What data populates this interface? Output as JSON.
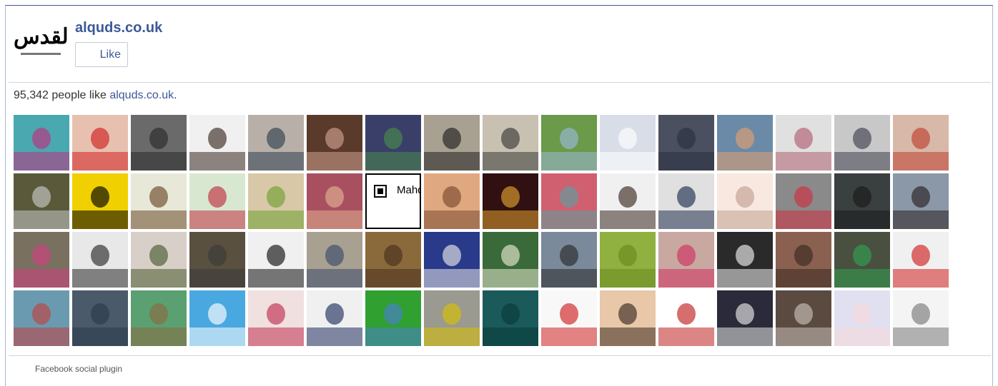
{
  "header": {
    "logo_text": "القدس",
    "page_name": "alquds.co.uk",
    "like_label": "Like"
  },
  "stats": {
    "count_text": "95,342 people like ",
    "page_link": "alquds.co.uk",
    "period": "."
  },
  "faces": [
    {
      "name": "friend-photo",
      "bg": "#4aa8b0",
      "accent": "#c03080",
      "text": ""
    },
    {
      "name": "friend-photo",
      "bg": "#e8c0b0",
      "accent": "#d02020",
      "text": ""
    },
    {
      "name": "friend-photo",
      "bg": "#6a6a6a",
      "accent": "#2a2a2a",
      "text": ""
    },
    {
      "name": "friend-photo",
      "bg": "#f0f0f0",
      "accent": "#3a2a20",
      "text": ""
    },
    {
      "name": "friend-photo",
      "bg": "#b8b0a8",
      "accent": "#304050",
      "text": ""
    },
    {
      "name": "friend-photo",
      "bg": "#5a3a2a",
      "accent": "#d0a090",
      "text": ""
    },
    {
      "name": "friend-photo",
      "bg": "#3a3f6a",
      "accent": "#4a8a4a",
      "text": ""
    },
    {
      "name": "friend-photo",
      "bg": "#a8a090",
      "accent": "#202020",
      "text": ""
    },
    {
      "name": "friend-photo",
      "bg": "#c8c0b0",
      "accent": "#3a3a3a",
      "text": ""
    },
    {
      "name": "friend-photo",
      "bg": "#6a9a4a",
      "accent": "#9ab8d8",
      "text": ""
    },
    {
      "name": "friend-photo",
      "bg": "#d8dde8",
      "accent": "#ffffff",
      "text": ""
    },
    {
      "name": "friend-photo",
      "bg": "#4a5060",
      "accent": "#2a3040",
      "text": ""
    },
    {
      "name": "friend-photo",
      "bg": "#6a8aa8",
      "accent": "#e0a070",
      "text": ""
    },
    {
      "name": "friend-photo",
      "bg": "#e0e0e0",
      "accent": "#b06070",
      "text": ""
    },
    {
      "name": "friend-photo",
      "bg": "#c8c8c8",
      "accent": "#404050",
      "text": ""
    },
    {
      "name": "friend-photo",
      "bg": "#d8b8a8",
      "accent": "#c04030",
      "text": ""
    },
    {
      "name": "friend-photo",
      "bg": "#5a5a3a",
      "accent": "#c8c8c8",
      "text": ""
    },
    {
      "name": "friend-photo",
      "bg": "#f0d000",
      "accent": "#000000",
      "text": ""
    },
    {
      "name": "friend-photo",
      "bg": "#e8e8d8",
      "accent": "#6a4a2a",
      "text": ""
    },
    {
      "name": "friend-photo",
      "bg": "#d8e8d0",
      "accent": "#c03040",
      "text": ""
    },
    {
      "name": "friend-photo",
      "bg": "#d8c8a8",
      "accent": "#70a030",
      "text": ""
    },
    {
      "name": "friend-photo",
      "bg": "#a85060",
      "accent": "#e0b090",
      "text": ""
    },
    {
      "name": "friend-photo-mahdi",
      "bg": "#ffffff",
      "accent": "#000000",
      "text": "Mahdi"
    },
    {
      "name": "friend-photo",
      "bg": "#e0a880",
      "accent": "#7a4a30",
      "text": ""
    },
    {
      "name": "friend-photo",
      "bg": "#301010",
      "accent": "#e0a030",
      "text": ""
    },
    {
      "name": "friend-photo",
      "bg": "#d06070",
      "accent": "#5aa0a0",
      "text": ""
    },
    {
      "name": "friend-photo",
      "bg": "#f0f0f0",
      "accent": "#3a2a20",
      "text": ""
    },
    {
      "name": "friend-photo",
      "bg": "#e0e0e0",
      "accent": "#203050",
      "text": ""
    },
    {
      "name": "friend-photo",
      "bg": "#f8e8e0",
      "accent": "#c0a090",
      "text": ""
    },
    {
      "name": "friend-photo",
      "bg": "#8a8a8a",
      "accent": "#d03040",
      "text": ""
    },
    {
      "name": "friend-photo",
      "bg": "#3a4040",
      "accent": "#1a1a1a",
      "text": ""
    },
    {
      "name": "friend-photo",
      "bg": "#8a98a8",
      "accent": "#2a2020",
      "text": ""
    },
    {
      "name": "friend-photo",
      "bg": "#7a7060",
      "accent": "#d04080",
      "text": ""
    },
    {
      "name": "friend-photo",
      "bg": "#e8e8e8",
      "accent": "#2a2a2a",
      "text": ""
    },
    {
      "name": "friend-photo",
      "bg": "#d8d0c8",
      "accent": "#4a5a30",
      "text": ""
    },
    {
      "name": "friend-photo",
      "bg": "#5a5040",
      "accent": "#3a3a3a",
      "text": ""
    },
    {
      "name": "friend-photo",
      "bg": "#f0f0f0",
      "accent": "#101010",
      "text": ""
    },
    {
      "name": "friend-photo",
      "bg": "#a8a090",
      "accent": "#3a4a6a",
      "text": ""
    },
    {
      "name": "friend-photo",
      "bg": "#8a6a3a",
      "accent": "#4a3020",
      "text": ""
    },
    {
      "name": "friend-photo",
      "bg": "#2a3a8a",
      "accent": "#e8e8e8",
      "text": ""
    },
    {
      "name": "friend-photo",
      "bg": "#3a6a3a",
      "accent": "#e8e8d0",
      "text": ""
    },
    {
      "name": "friend-photo",
      "bg": "#7a8a9a",
      "accent": "#2a2a2a",
      "text": ""
    },
    {
      "name": "friend-photo",
      "bg": "#90b040",
      "accent": "#6a8a20",
      "text": ""
    },
    {
      "name": "friend-photo",
      "bg": "#c8a8a0",
      "accent": "#d03060",
      "text": ""
    },
    {
      "name": "friend-photo",
      "bg": "#2a2a2a",
      "accent": "#f0f0f0",
      "text": ""
    },
    {
      "name": "friend-photo",
      "bg": "#8a6050",
      "accent": "#3a2a20",
      "text": ""
    },
    {
      "name": "friend-photo",
      "bg": "#4a5040",
      "accent": "#30a050",
      "text": ""
    },
    {
      "name": "friend-photo",
      "bg": "#f0f0f0",
      "accent": "#d02020",
      "text": ""
    },
    {
      "name": "friend-photo",
      "bg": "#6a9ab0",
      "accent": "#c04040",
      "text": ""
    },
    {
      "name": "friend-photo",
      "bg": "#4a5a6a",
      "accent": "#2a3a4a",
      "text": ""
    },
    {
      "name": "friend-photo",
      "bg": "#5aa070",
      "accent": "#8a6a40",
      "text": ""
    },
    {
      "name": "friend-photo",
      "bg": "#4aa8e0",
      "accent": "#ffffff",
      "text": ""
    },
    {
      "name": "friend-photo",
      "bg": "#f0e0e0",
      "accent": "#c03050",
      "text": ""
    },
    {
      "name": "friend-photo",
      "bg": "#f0f0f0",
      "accent": "#203060",
      "text": ""
    },
    {
      "name": "friend-photo",
      "bg": "#30a030",
      "accent": "#4a80d0",
      "text": ""
    },
    {
      "name": "friend-photo",
      "bg": "#9a9a90",
      "accent": "#d8c000",
      "text": ""
    },
    {
      "name": "friend-photo",
      "bg": "#1a5a5a",
      "accent": "#0a3a3a",
      "text": ""
    },
    {
      "name": "friend-photo",
      "bg": "#f8f8f8",
      "accent": "#d02020",
      "text": ""
    },
    {
      "name": "friend-photo",
      "bg": "#e8c8a8",
      "accent": "#3a2a20",
      "text": ""
    },
    {
      "name": "friend-photo",
      "bg": "#ffffff",
      "accent": "#c02020",
      "text": ""
    },
    {
      "name": "friend-photo",
      "bg": "#2a2a3a",
      "accent": "#e8e8e8",
      "text": ""
    },
    {
      "name": "friend-photo",
      "bg": "#5a4a40",
      "accent": "#c8c0b8",
      "text": ""
    },
    {
      "name": "friend-photo",
      "bg": "#e0e0f0",
      "accent": "#f8d8d8",
      "text": ""
    },
    {
      "name": "friend-photo",
      "bg": "#f4f4f4",
      "accent": "#7a7a7a",
      "text": ""
    }
  ],
  "footer": {
    "label": "Facebook social plugin"
  }
}
